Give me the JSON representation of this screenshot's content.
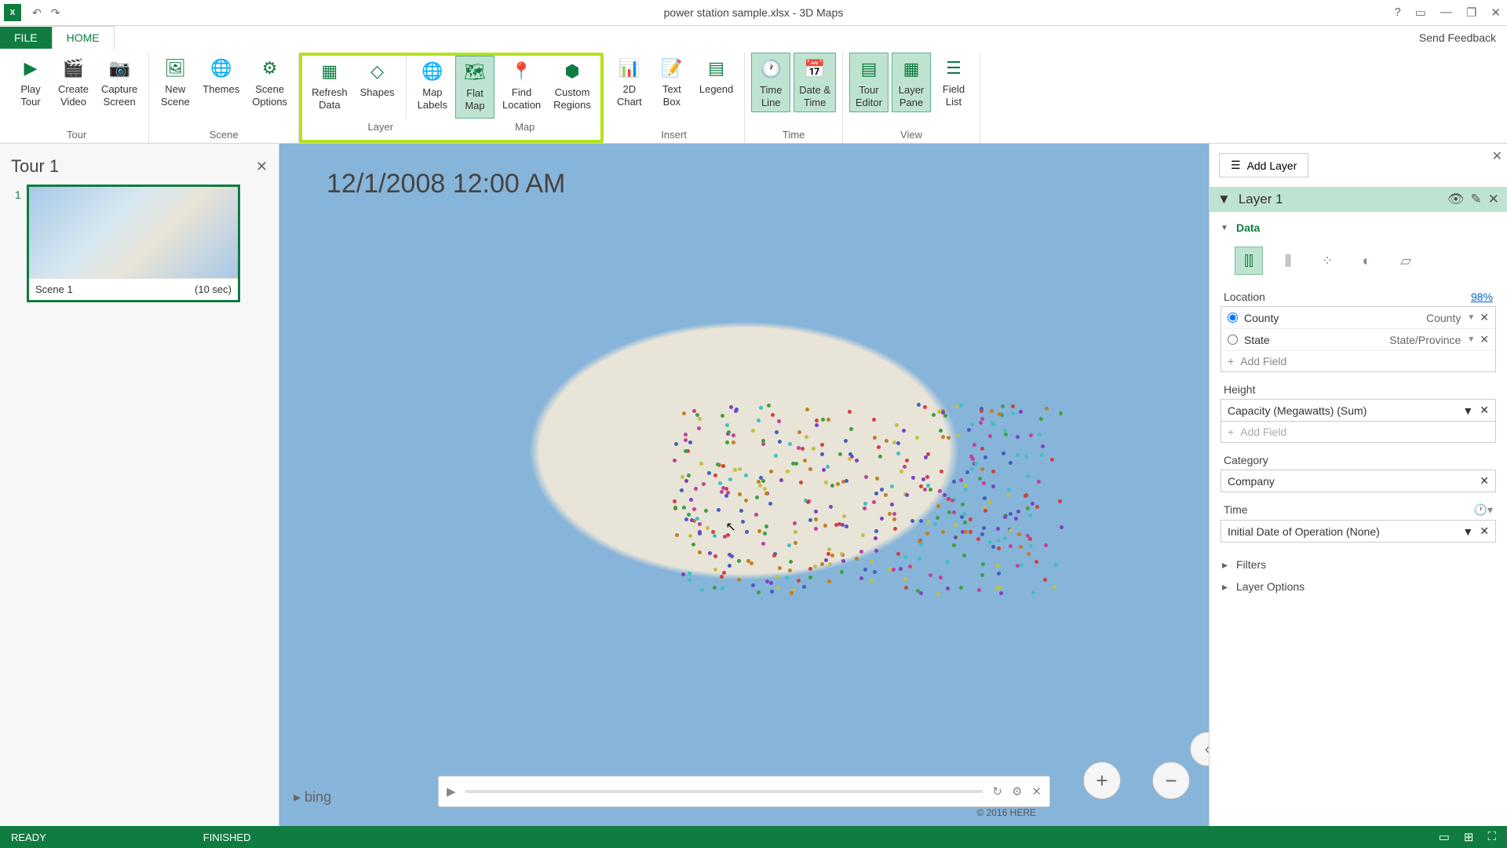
{
  "titlebar": {
    "title": "power station sample.xlsx - 3D Maps"
  },
  "tabs": {
    "file": "FILE",
    "home": "HOME",
    "feedback": "Send Feedback"
  },
  "ribbon": {
    "tour": {
      "label": "Tour",
      "play": "Play\nTour",
      "create": "Create\nVideo",
      "capture": "Capture\nScreen"
    },
    "scene": {
      "label": "Scene",
      "new": "New\nScene",
      "themes": "Themes",
      "options": "Scene\nOptions"
    },
    "layer": {
      "label": "Layer",
      "refresh": "Refresh\nData",
      "shapes": "Shapes"
    },
    "map": {
      "label": "Map",
      "labels": "Map\nLabels",
      "flat": "Flat\nMap",
      "find": "Find\nLocation",
      "regions": "Custom\nRegions"
    },
    "insert": {
      "label": "Insert",
      "chart": "2D\nChart",
      "text": "Text\nBox",
      "legend": "Legend"
    },
    "time": {
      "label": "Time",
      "timeline": "Time\nLine",
      "datetime": "Date &\nTime"
    },
    "view": {
      "label": "View",
      "tour": "Tour\nEditor",
      "layer": "Layer\nPane",
      "field": "Field\nList"
    }
  },
  "tour": {
    "title": "Tour 1",
    "scene_num": "1",
    "scene_name": "Scene 1",
    "scene_dur": "(10 sec)"
  },
  "map": {
    "timestamp": "12/1/2008 12:00 AM",
    "bing": "bing",
    "copyright": "© 2016 HERE"
  },
  "layerpane": {
    "add": "Add Layer",
    "name": "Layer 1",
    "data": "Data",
    "location": {
      "label": "Location",
      "pct": "98%",
      "county": "County",
      "county_type": "County",
      "state": "State",
      "state_type": "State/Province",
      "add": "Add Field"
    },
    "height": {
      "label": "Height",
      "field": "Capacity (Megawatts) (Sum)",
      "add": "Add Field"
    },
    "category": {
      "label": "Category",
      "field": "Company"
    },
    "time": {
      "label": "Time",
      "field": "Initial Date of Operation (None)"
    },
    "filters": "Filters",
    "options": "Layer Options"
  },
  "status": {
    "ready": "READY",
    "finished": "FINISHED"
  }
}
